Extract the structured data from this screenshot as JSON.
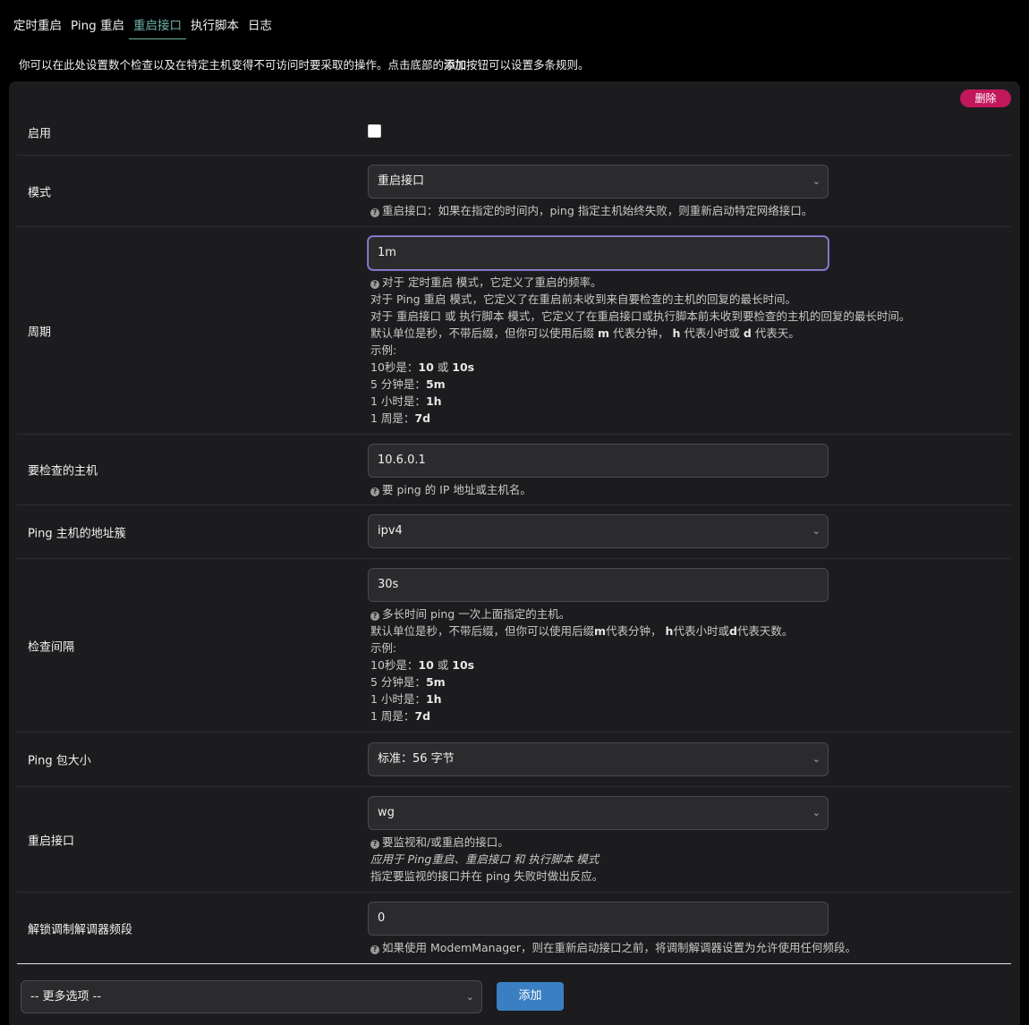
{
  "tabs": [
    {
      "label": "定时重启",
      "active": false
    },
    {
      "label": "Ping 重启",
      "active": false
    },
    {
      "label": "重启接口",
      "active": true
    },
    {
      "label": "执行脚本",
      "active": false
    },
    {
      "label": "日志",
      "active": false
    }
  ],
  "description": {
    "before": "你可以在此处设置数个检查以及在特定主机变得不可访问时要采取的操作。点击底部的",
    "bold": "添加",
    "after": "按钮可以设置多条规则。"
  },
  "delete_label": "删除",
  "enable": {
    "label": "启用",
    "checked": false
  },
  "mode": {
    "label": "模式",
    "value": "重启接口",
    "help": "重启接口：如果在指定的时间内，ping 指定主机始终失败，则重新启动特定网络接口。"
  },
  "period": {
    "label": "周期",
    "value": "1m",
    "help_lines": [
      "对于 定时重启 模式，它定义了重启的频率。",
      "对于 Ping 重启 模式，它定义了在重启前未收到来自要检查的主机的回复的最长时间。",
      "对于 重启接口 或 执行脚本 模式，它定义了在重启接口或执行脚本前未收到要检查的主机的回复的最长时间。"
    ],
    "unit_line": {
      "a": "默认单位是秒，不带后缀，但你可以使用后缀 ",
      "m": "m",
      "b": " 代表分钟， ",
      "h": "h",
      "c": " 代表小时或 ",
      "d": "d",
      "e": " 代表天。"
    },
    "examples_label": "示例:",
    "examples": [
      {
        "prefix": "10秒是：",
        "v1": "10",
        "or": " 或 ",
        "v2": "10s"
      },
      {
        "prefix": "5 分钟是：",
        "v1": "5m"
      },
      {
        "prefix": "1 小时是：",
        "v1": "1h"
      },
      {
        "prefix": "1 周是：",
        "v1": "7d"
      }
    ]
  },
  "host": {
    "label": "要检查的主机",
    "value": "10.6.0.1",
    "help": "要 ping 的 IP 地址或主机名。"
  },
  "family": {
    "label": "Ping 主机的地址簇",
    "value": "ipv4"
  },
  "interval": {
    "label": "检查间隔",
    "value": "30s",
    "help": "多长时间 ping 一次上面指定的主机。",
    "unit_line": {
      "a": "默认单位是秒，不带后缀，但你可以使用后缀",
      "m": "m",
      "b": "代表分钟， ",
      "h": "h",
      "c": "代表小时或",
      "d": "d",
      "e": "代表天数。"
    },
    "examples_label": "示例:",
    "examples": [
      {
        "prefix": "10秒是：",
        "v1": "10",
        "or": " 或 ",
        "v2": "10s"
      },
      {
        "prefix": "5 分钟是：",
        "v1": "5m"
      },
      {
        "prefix": "1 小时是：",
        "v1": "1h"
      },
      {
        "prefix": "1 周是：",
        "v1": "7d"
      }
    ]
  },
  "packet_size": {
    "label": "Ping 包大小",
    "value": "标准：56 字节"
  },
  "iface": {
    "label": "重启接口",
    "value": "wg",
    "help": "要监视和/或重启的接口。",
    "help_italic": "应用于 Ping重启、重启接口 和 执行脚本 模式",
    "help2": "指定要监视的接口并在 ping 失败时做出反应。"
  },
  "unlock": {
    "label": "解锁调制解调器频段",
    "value": "0",
    "help": "如果使用 ModemManager，则在重新启动接口之前，将调制解调器设置为允许使用任何频段。"
  },
  "more_options": "-- 更多选项 --",
  "add_label": "添加"
}
